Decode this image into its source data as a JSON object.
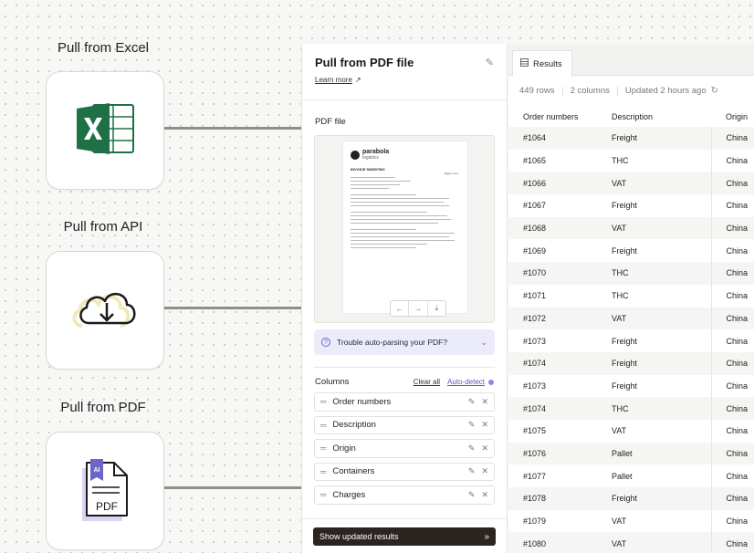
{
  "steps": [
    {
      "label": "Pull from Excel",
      "icon": "excel-icon"
    },
    {
      "label": "Pull from API",
      "icon": "cloud-download-icon"
    },
    {
      "label": "Pull from PDF",
      "icon": "ai-pdf-icon"
    }
  ],
  "panel": {
    "title": "Pull from PDF file",
    "learn_more": "Learn more",
    "pdf_section": "PDF file",
    "pdf_preview": {
      "brand": "parabola",
      "brand_sub": "logistics",
      "invoice": "INVOICE 565597500",
      "page": "Page 1 of 1"
    },
    "trouble": "Trouble auto-parsing your PDF?",
    "columns_title": "Columns",
    "clear_all": "Clear all",
    "auto_detect": "Auto-detect",
    "columns": [
      "Order numbers",
      "Description",
      "Origin",
      "Containers",
      "Charges"
    ],
    "update_button": "Show updated results"
  },
  "results": {
    "tab": "Results",
    "rows_count": "449 rows",
    "columns_count": "2 columns",
    "updated": "Updated 2 hours ago",
    "headers": [
      "Order numbers",
      "Description",
      "Origin"
    ],
    "rows": [
      [
        "#1064",
        "Freight",
        "China"
      ],
      [
        "#1065",
        "THC",
        "China"
      ],
      [
        "#1066",
        "VAT",
        "China"
      ],
      [
        "#1067",
        "Freight",
        "China"
      ],
      [
        "#1068",
        "VAT",
        "China"
      ],
      [
        "#1069",
        "Freight",
        "China"
      ],
      [
        "#1070",
        "THC",
        "China"
      ],
      [
        "#1071",
        "THC",
        "China"
      ],
      [
        "#1072",
        "VAT",
        "China"
      ],
      [
        "#1073",
        "Freight",
        "China"
      ],
      [
        "#1074",
        "Freight",
        "China"
      ],
      [
        "#1073",
        "Freight",
        "China"
      ],
      [
        "#1074",
        "THC",
        "China"
      ],
      [
        "#1075",
        "VAT",
        "China"
      ],
      [
        "#1076",
        "Pallet",
        "China"
      ],
      [
        "#1077",
        "Pallet",
        "China"
      ],
      [
        "#1078",
        "Freight",
        "China"
      ],
      [
        "#1079",
        "VAT",
        "China"
      ],
      [
        "#1080",
        "VAT",
        "China"
      ]
    ]
  },
  "colors": {
    "excel_green": "#1e7145",
    "accent_purple": "#5b57c4",
    "button_dark": "#2b2420"
  }
}
